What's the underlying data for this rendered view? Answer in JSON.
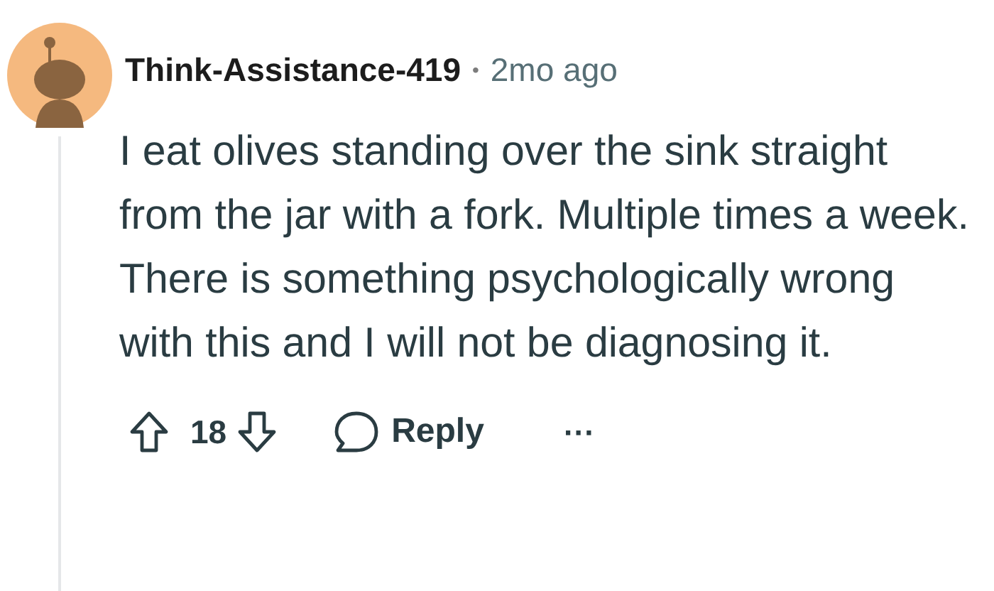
{
  "comment": {
    "author": "Think-Assistance-419",
    "separator": "•",
    "age": "2mo ago",
    "body": "I eat olives standing over the sink straight from the jar with a fork. Multiple times a week. There is something psychologically wrong with this and I will not be diagnosing it.",
    "score": "18",
    "reply_label": "Reply",
    "more": "···"
  }
}
